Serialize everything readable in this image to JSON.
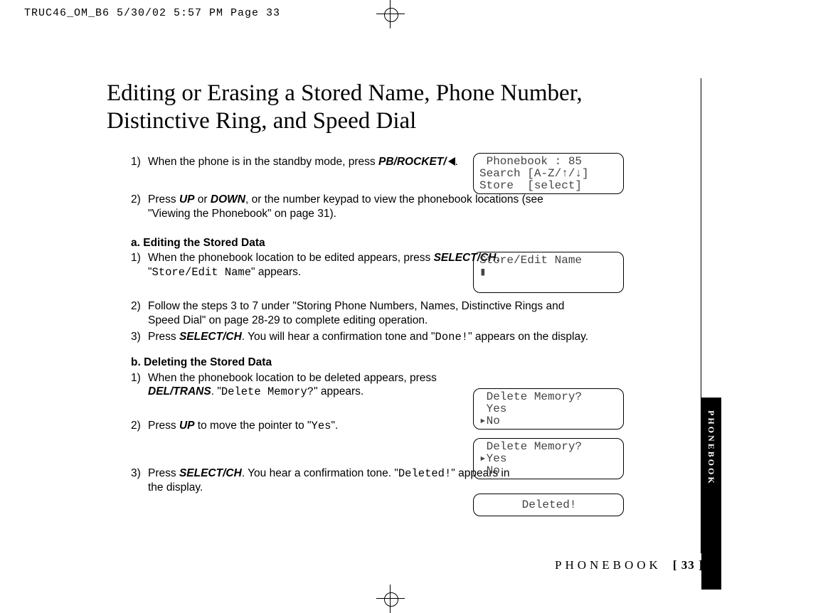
{
  "header": "TRUC46_OM_B6  5/30/02  5:57 PM  Page 33",
  "title": "Editing or Erasing a Stored Name, Phone Number, Distinctive Ring, and Speed Dial",
  "intro": {
    "step1_pre": "When the phone is in the standby mode, press ",
    "step1_key": "PB/ROCKET/",
    "step1_post": ".",
    "step2_pre": "Press ",
    "step2_up": "UP",
    "step2_or": " or ",
    "step2_down": "DOWN",
    "step2_post": ", or the number keypad to view the phonebook locations (see \"Viewing the Phonebook\" on page 31)."
  },
  "sectionA": {
    "head": "a. Editing the Stored Data",
    "s1_pre": "When the phonebook location to be edited appears, press ",
    "s1_key": "SELECT/CH",
    "s1_mid": ". \"",
    "s1_mono": "Store/Edit Name",
    "s1_post": "\" appears.",
    "s2": "Follow the steps 3 to 7 under \"Storing Phone Numbers, Names, Distinctive Rings and Speed Dial\" on page 28-29 to complete editing operation.",
    "s3_pre": "Press ",
    "s3_key": "SELECT/CH",
    "s3_mid": ". You will hear a confirmation tone and \"",
    "s3_mono": "Done!",
    "s3_post": "\" appears on the display."
  },
  "sectionB": {
    "head": "b. Deleting the Stored Data",
    "s1_pre": "When the phonebook location to be deleted appears, press ",
    "s1_key": "DEL/TRANS",
    "s1_mid": ". \"",
    "s1_mono": "Delete Memory?",
    "s1_post": "\" appears.",
    "s2_pre": "Press ",
    "s2_key": "UP",
    "s2_mid": " to move the pointer to \"",
    "s2_mono": "Yes",
    "s2_post": "\".",
    "s3_pre": "Press ",
    "s3_key": "SELECT/CH",
    "s3_mid": ". You hear a confirmation tone. \"",
    "s3_mono": "Deleted!",
    "s3_post": "\" appears in the display."
  },
  "lcd1": " Phonebook : 85\nSearch [A-Z/↑/↓]\nStore  [select]",
  "lcd2": "Store/Edit Name\n▮",
  "lcd3": " Delete Memory?\n Yes\n▸No",
  "lcd4": " Delete Memory?\n▸Yes\n No",
  "lcd5": "Deleted!",
  "footer_section": "PHONEBOOK",
  "footer_page": "[ 33 ]",
  "sidetab": "PHONEBOOK"
}
